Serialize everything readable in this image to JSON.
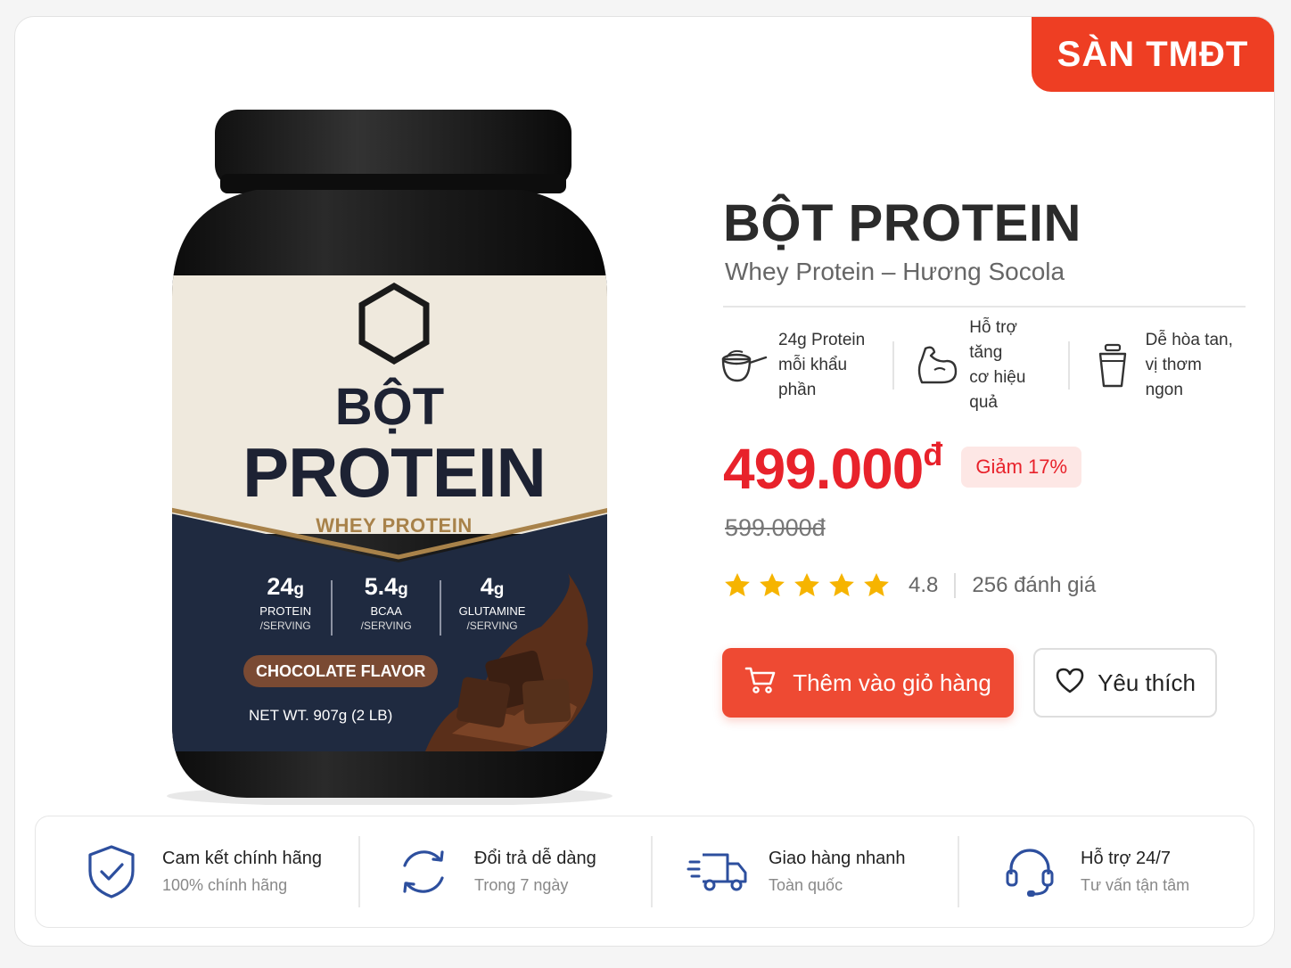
{
  "badge": "SÀN TMĐT",
  "product": {
    "title": "BỘT PROTEIN",
    "subtitle": "Whey Protein – Hương Socola",
    "label": {
      "line1": "BỘT",
      "line2": "PROTEIN",
      "line3": "WHEY PROTEIN",
      "stats": [
        {
          "value": "24",
          "unit": "g",
          "name": "PROTEIN",
          "per": "/SERVING"
        },
        {
          "value": "5.4",
          "unit": "g",
          "name": "BCAA",
          "per": "/SERVING"
        },
        {
          "value": "4",
          "unit": "g",
          "name": "GLUTAMINE",
          "per": "/SERVING"
        }
      ],
      "flavor": "CHOCOLATE FLAVOR",
      "net_weight": "NET WT. 907g (2 LB)"
    }
  },
  "features": [
    {
      "icon": "scoop-icon",
      "line1": "24g Protein",
      "line2": "mỗi khẩu phần"
    },
    {
      "icon": "muscle-icon",
      "line1": "Hỗ trợ tăng",
      "line2": "cơ hiệu quả"
    },
    {
      "icon": "shaker-icon",
      "line1": "Dễ hòa tan,",
      "line2": "vị thơm ngon"
    }
  ],
  "pricing": {
    "price": "499.000",
    "currency": "đ",
    "discount": "Giảm 17%",
    "old_price": "599.000đ"
  },
  "rating": {
    "stars": 5,
    "score": "4.8",
    "reviews": "256 đánh giá"
  },
  "actions": {
    "add_to_cart": "Thêm vào giỏ hàng",
    "favorite": "Yêu thích"
  },
  "colors": {
    "accent": "#ee4a33",
    "price": "#e8222b",
    "star": "#f6b400",
    "icon_blue": "#2d4f9e",
    "label_navy": "#1f2a40",
    "label_cream": "#efe9dd",
    "label_gold": "#a8824a"
  },
  "benefits": [
    {
      "icon": "shield-check-icon",
      "title": "Cam kết chính hãng",
      "sub": "100% chính hãng"
    },
    {
      "icon": "return-arrows-icon",
      "title": "Đổi trả dễ dàng",
      "sub": "Trong 7 ngày"
    },
    {
      "icon": "delivery-truck-icon",
      "title": "Giao hàng nhanh",
      "sub": "Toàn quốc"
    },
    {
      "icon": "headset-icon",
      "title": "Hỗ trợ 24/7",
      "sub": "Tư vấn tận tâm"
    }
  ]
}
